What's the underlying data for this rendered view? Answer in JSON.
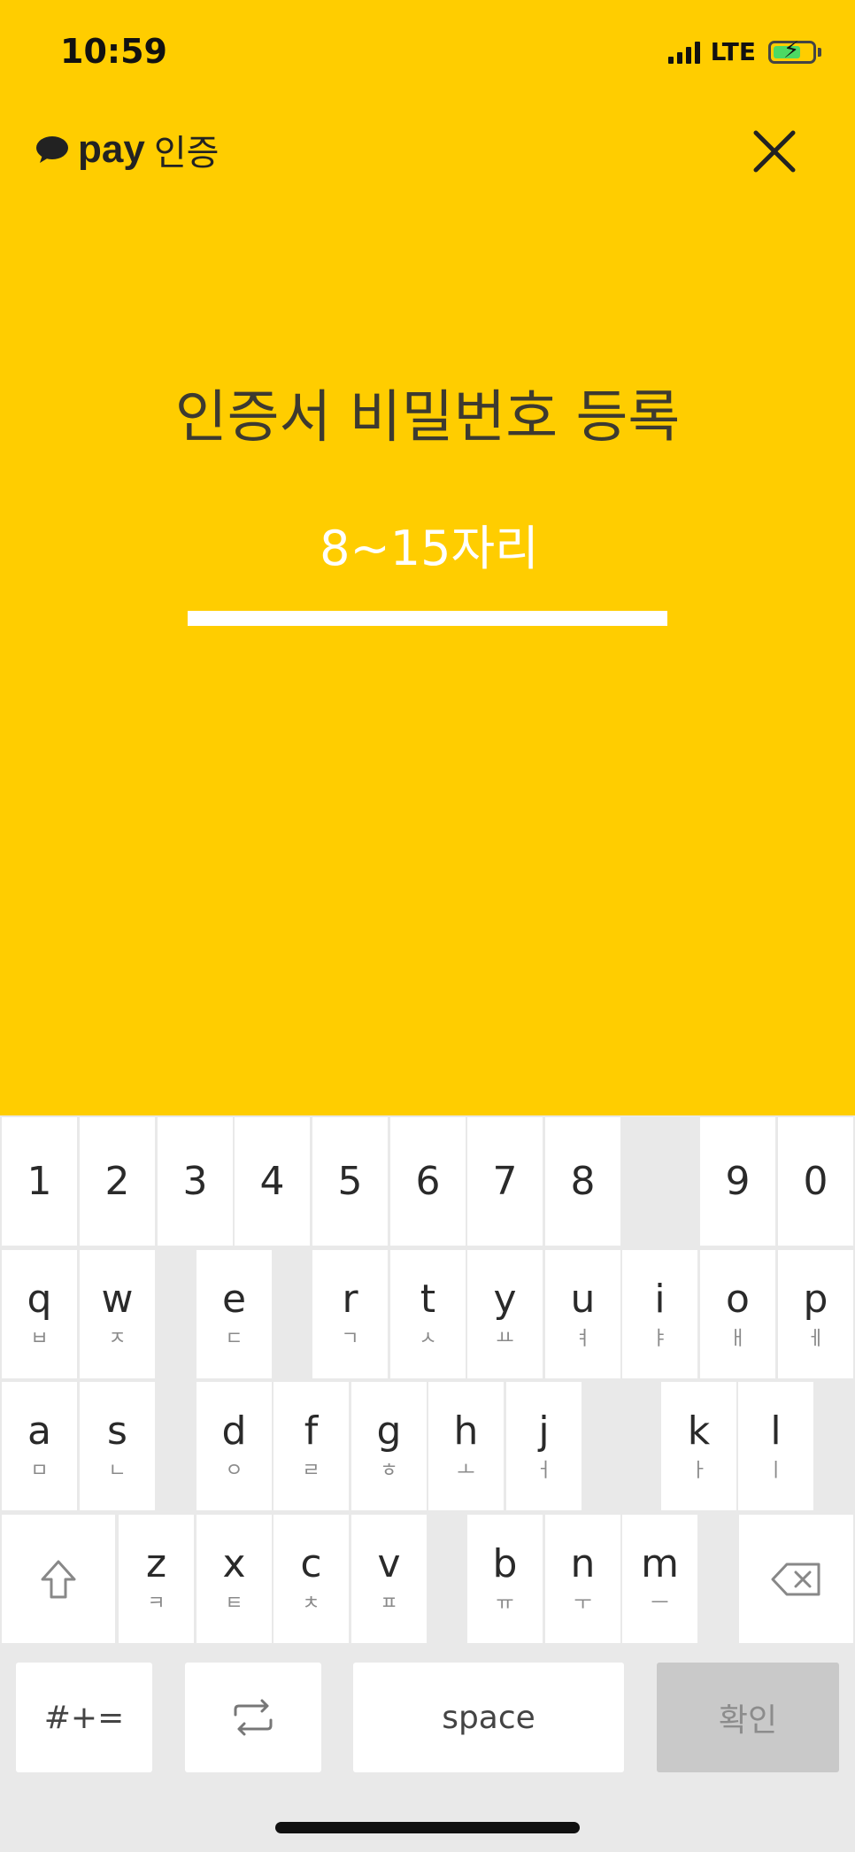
{
  "status": {
    "time": "10:59",
    "network": "LTE"
  },
  "header": {
    "logo_pay": "pay",
    "logo_label": "인증"
  },
  "title": "인증서 비밀번호 등록",
  "password": {
    "placeholder": "8~15자리",
    "value": ""
  },
  "keyboard": {
    "numbers": [
      "1",
      "2",
      "3",
      "4",
      "5",
      "6",
      "7",
      "8",
      "9",
      "0"
    ],
    "row1": [
      {
        "main": "q",
        "sub": "ㅂ"
      },
      {
        "main": "w",
        "sub": "ㅈ"
      },
      {
        "main": "e",
        "sub": "ㄷ"
      },
      {
        "main": "r",
        "sub": "ㄱ"
      },
      {
        "main": "t",
        "sub": "ㅅ"
      },
      {
        "main": "y",
        "sub": "ㅛ"
      },
      {
        "main": "u",
        "sub": "ㅕ"
      },
      {
        "main": "i",
        "sub": "ㅑ"
      },
      {
        "main": "o",
        "sub": "ㅐ"
      },
      {
        "main": "p",
        "sub": "ㅔ"
      }
    ],
    "row2": [
      {
        "main": "a",
        "sub": "ㅁ"
      },
      {
        "main": "s",
        "sub": "ㄴ"
      },
      {
        "main": "d",
        "sub": "ㅇ"
      },
      {
        "main": "f",
        "sub": "ㄹ"
      },
      {
        "main": "g",
        "sub": "ㅎ"
      },
      {
        "main": "h",
        "sub": "ㅗ"
      },
      {
        "main": "j",
        "sub": "ㅓ"
      },
      {
        "main": "k",
        "sub": "ㅏ"
      },
      {
        "main": "l",
        "sub": "ㅣ"
      }
    ],
    "row3": [
      {
        "main": "z",
        "sub": "ㅋ"
      },
      {
        "main": "x",
        "sub": "ㅌ"
      },
      {
        "main": "c",
        "sub": "ㅊ"
      },
      {
        "main": "v",
        "sub": "ㅍ"
      },
      {
        "main": "b",
        "sub": "ㅠ"
      },
      {
        "main": "n",
        "sub": "ㅜ"
      },
      {
        "main": "m",
        "sub": "ㅡ"
      }
    ],
    "symbols_label": "#+=",
    "space_label": "space",
    "confirm_label": "확인"
  }
}
